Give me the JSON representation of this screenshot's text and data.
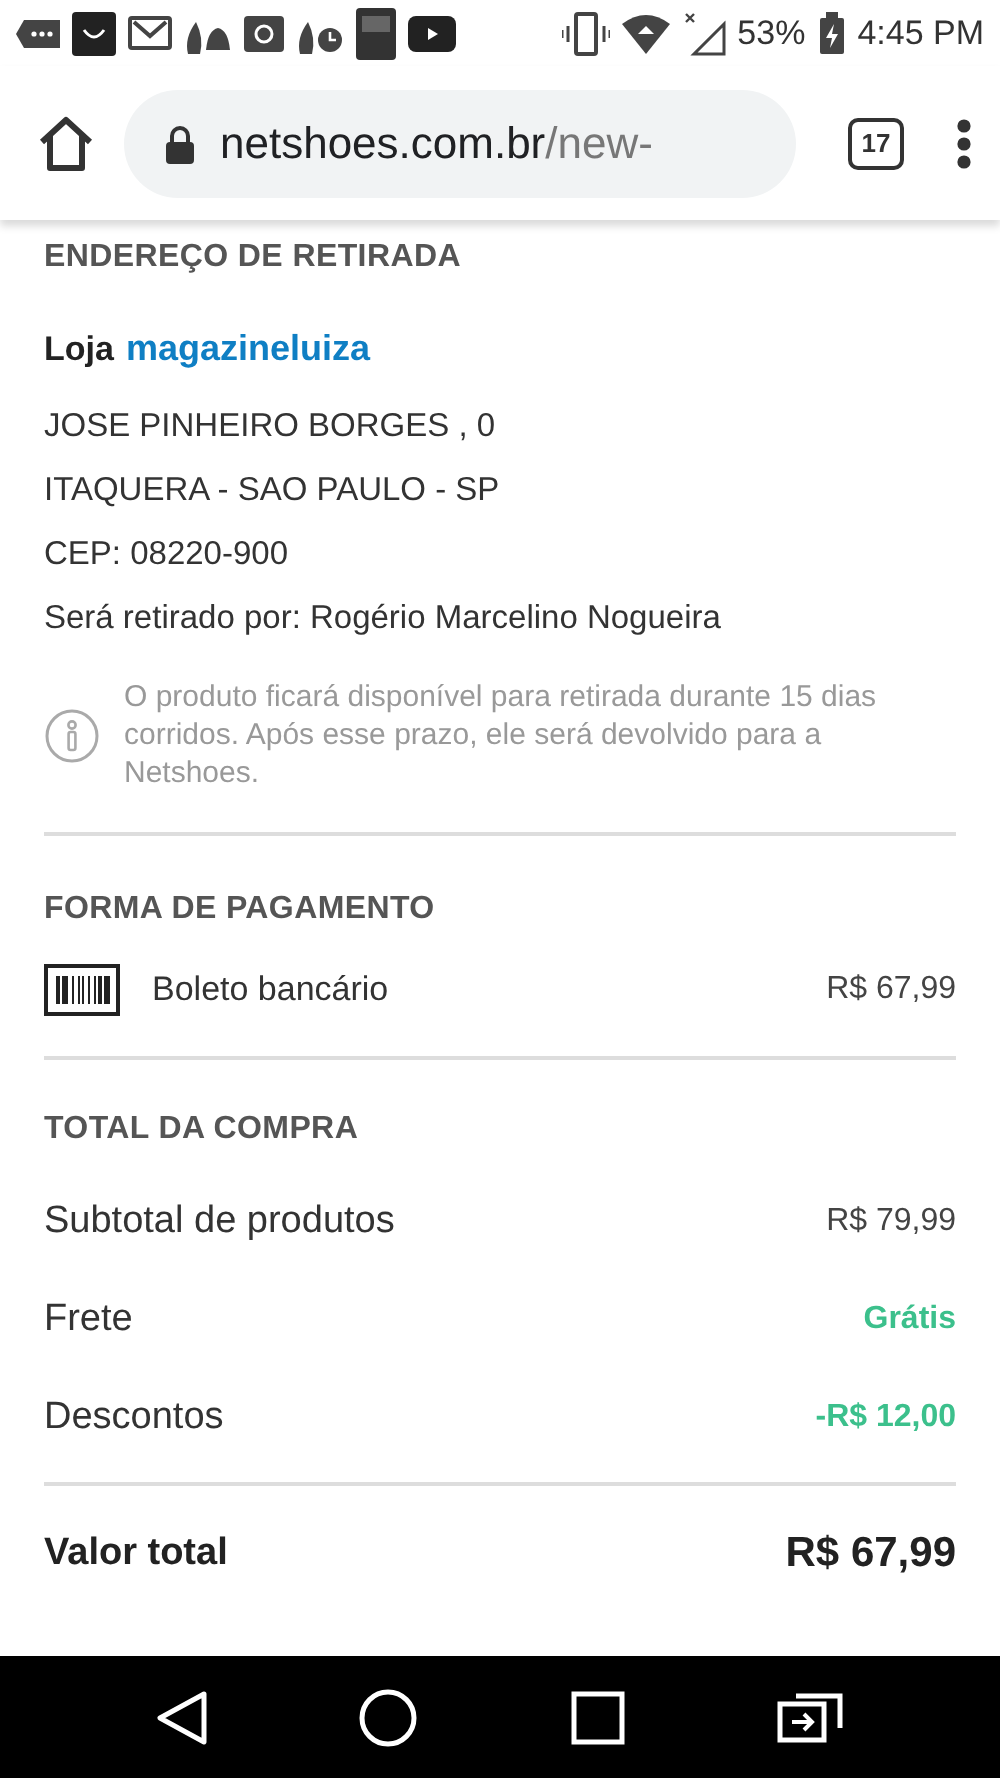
{
  "status_bar": {
    "battery": "53%",
    "time": "4:45 PM"
  },
  "browser": {
    "url_host": "netshoes.com.br",
    "url_path": "/new-",
    "tab_count": "17"
  },
  "pickup": {
    "heading": "ENDEREÇO DE RETIRADA",
    "store_label": "Loja",
    "store_brand": "magazineluiza",
    "address_lines": [
      "JOSE PINHEIRO BORGES , 0",
      "ITAQUERA - SAO PAULO - SP",
      "CEP: 08220-900",
      "Será retirado por: Rogério Marcelino Nogueira"
    ],
    "note": "O produto ficará disponível para retirada durante 15 dias corridos. Após esse prazo, ele será devolvido para a Netshoes."
  },
  "payment": {
    "heading": "FORMA DE PAGAMENTO",
    "method": "Boleto bancário",
    "amount": "R$ 67,99"
  },
  "totals": {
    "heading": "TOTAL DA COMPRA",
    "rows": [
      {
        "label": "Subtotal de produtos",
        "value": "R$ 79,99",
        "kind": "plain"
      },
      {
        "label": "Frete",
        "value": "Grátis",
        "kind": "discount"
      },
      {
        "label": "Descontos",
        "value": "-R$ 12,00",
        "kind": "discount"
      }
    ],
    "grand_label": "Valor total",
    "grand_value": "R$ 67,99"
  }
}
